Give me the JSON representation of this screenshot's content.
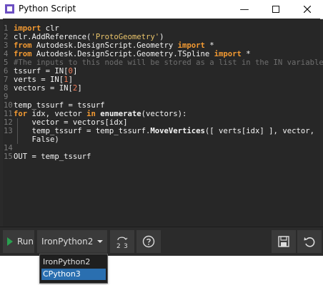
{
  "window": {
    "title": "Python Script"
  },
  "editor": {
    "lines": [
      {
        "n": "1",
        "text": "import clr"
      },
      {
        "n": "2",
        "text": "clr.AddReference('ProtoGeometry')"
      },
      {
        "n": "3",
        "text": "from Autodesk.DesignScript.Geometry import *"
      },
      {
        "n": "4",
        "text": "from Autodesk.DesignScript.Geometry.TSpline import *"
      },
      {
        "n": "5",
        "text": "#The inputs to this node will be stored as a list in the IN variables."
      },
      {
        "n": "6",
        "text": "tssurf = IN[0]"
      },
      {
        "n": "7",
        "text": "verts = IN[1]"
      },
      {
        "n": "8",
        "text": "vectors = IN[2]"
      },
      {
        "n": "9",
        "text": ""
      },
      {
        "n": "10",
        "text": "temp_tssurf = tssurf"
      },
      {
        "n": "11",
        "text": "for idx, vector in enumerate(vectors):"
      },
      {
        "n": "12",
        "text": "    vector = vectors[idx]"
      },
      {
        "n": "13",
        "text": "    temp_tssurf = temp_tssurf.MoveVertices([ verts[idx] ], vector,"
      },
      {
        "n": "",
        "text": "    False)"
      },
      {
        "n": "14",
        "text": ""
      },
      {
        "n": "15",
        "text": "OUT = temp_tssurf"
      }
    ]
  },
  "toolbar": {
    "run_label": "Run",
    "engine_value": "IronPython2",
    "engine_options": [
      "IronPython2",
      "CPython3"
    ],
    "engine_highlighted": "CPython3"
  },
  "colors": {
    "keyword": "#f39a32",
    "string": "#eac46b",
    "comment": "#6f6f6f",
    "number": "#f47f5c",
    "run_icon": "#29a04f",
    "selection": "#2a6fb0"
  }
}
